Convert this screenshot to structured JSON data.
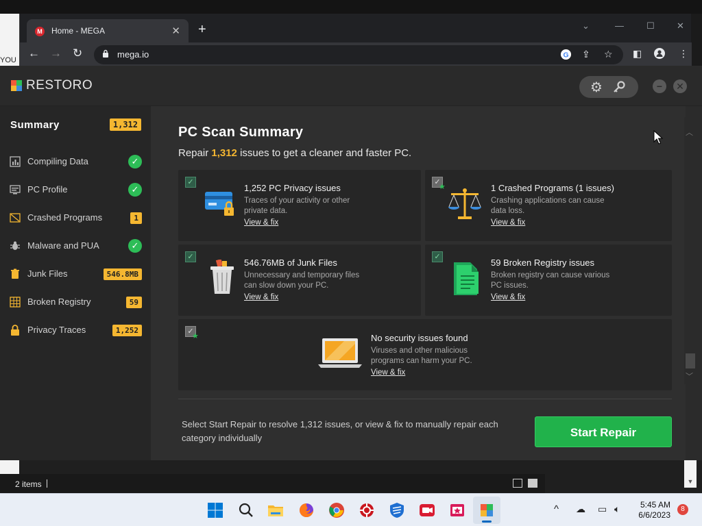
{
  "desktop": {
    "left_fragment": "YOU"
  },
  "browser": {
    "tab_title": "Home - MEGA",
    "favicon_text": "M",
    "url": "mega.io"
  },
  "restoro": {
    "logo_text": "RESTORO",
    "sidebar": {
      "summary_label": "Summary",
      "summary_count": "1,312",
      "items": [
        {
          "label": "Compiling Data",
          "icon": "chart-icon",
          "status": "check"
        },
        {
          "label": "PC Profile",
          "icon": "monitor-icon",
          "status": "check"
        },
        {
          "label": "Crashed Programs",
          "icon": "crashed-window-icon",
          "badge": "1"
        },
        {
          "label": "Malware and PUA",
          "icon": "bug-icon",
          "status": "check"
        },
        {
          "label": "Junk Files",
          "icon": "trash-icon",
          "badge": "546.8MB"
        },
        {
          "label": "Broken Registry",
          "icon": "registry-grid-icon",
          "badge": "59"
        },
        {
          "label": "Privacy Traces",
          "icon": "lock-icon",
          "badge": "1,252"
        }
      ]
    },
    "main": {
      "title": "PC Scan Summary",
      "subtitle_prefix": "Repair ",
      "subtitle_count": "1,312",
      "subtitle_suffix": " issues to get a cleaner and faster PC.",
      "cards": [
        {
          "title": "1,252 PC Privacy issues",
          "desc1": "Traces of your activity or other",
          "desc2": "private data.",
          "link": "View & fix",
          "icon": "credit-card-lock-icon"
        },
        {
          "title": "1 Crashed Programs (1 issues)",
          "desc1": "Crashing applications can cause",
          "desc2": "data loss.",
          "link": "View & fix",
          "icon": "scales-icon"
        },
        {
          "title": "546.76MB of Junk Files",
          "desc1": "Unnecessary and temporary files",
          "desc2": "can slow down your PC.",
          "link": "View & fix",
          "icon": "trash-can-icon"
        },
        {
          "title": "59 Broken Registry issues",
          "desc1": "Broken registry can cause various",
          "desc2": "PC issues.",
          "link": "View & fix",
          "icon": "registry-document-icon"
        },
        {
          "title": "No security issues found",
          "desc1": "Viruses and other malicious",
          "desc2": "programs can harm your PC.",
          "link": "View & fix",
          "icon": "laptop-icon"
        }
      ],
      "footer_text": "Select Start Repair to resolve 1,312 issues, or view & fix to manually repair each category individually",
      "start_repair_label": "Start Repair"
    }
  },
  "explorer": {
    "items_label": "2 items"
  },
  "taskbar": {
    "time": "5:45 AM",
    "date": "6/6/2023",
    "notification_count": "8"
  },
  "colors": {
    "accent_yellow": "#f5b731",
    "success_green": "#2dbd57",
    "button_green": "#21b24b"
  }
}
